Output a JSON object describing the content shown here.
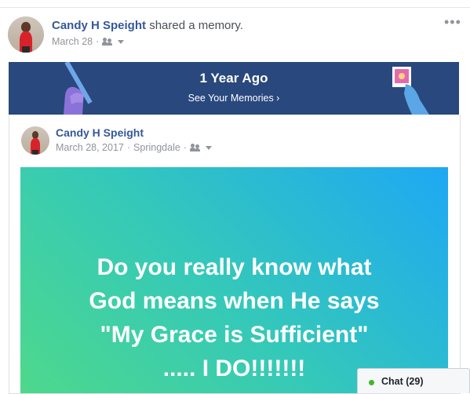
{
  "post": {
    "author": "Candy H Speight",
    "action": "shared a memory.",
    "date": "March 28",
    "more_icon": "ellipsis-icon",
    "audience_icon": "friends-icon"
  },
  "memory_banner": {
    "title": "1 Year Ago",
    "link": "See Your Memories ›",
    "background": "#29487d"
  },
  "shared_post": {
    "author": "Candy H Speight",
    "date": "March 28, 2017",
    "location": "Springdale",
    "quote_lines": [
      "Do you really know what",
      "God means when He says",
      "\"My Grace is Sufficient\"",
      "..... I DO!!!!!!!"
    ],
    "gradient": [
      "#4ed88c",
      "#1ea8f4"
    ]
  },
  "chat": {
    "label": "Chat (29)",
    "status_color": "#42b72a"
  }
}
